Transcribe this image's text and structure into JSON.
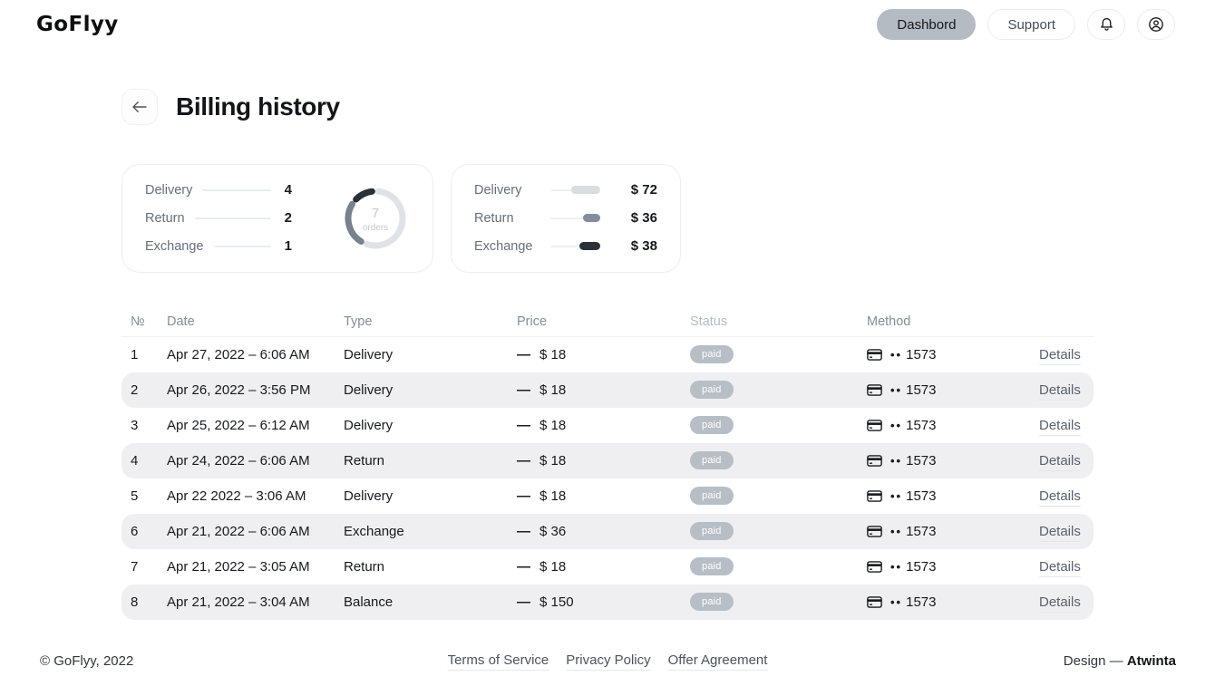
{
  "header": {
    "logo": "GoFlyy",
    "nav": [
      {
        "label": "Dashbord",
        "active": true
      },
      {
        "label": "Support",
        "active": false
      }
    ],
    "icons": {
      "notifications": "bell-icon",
      "account": "profile-icon"
    }
  },
  "page": {
    "title": "Billing history"
  },
  "summary": {
    "orders": {
      "items": [
        {
          "label": "Delivery",
          "value": "4"
        },
        {
          "label": "Return",
          "value": "2"
        },
        {
          "label": "Exchange",
          "value": "1"
        }
      ],
      "donut": {
        "total": "7",
        "unit": "orders"
      }
    },
    "amounts": {
      "items": [
        {
          "label": "Delivery",
          "value": "$ 72",
          "bar_pct": 58,
          "color": "#d9dde2"
        },
        {
          "label": "Return",
          "value": "$ 36",
          "bar_pct": 34,
          "color": "#848d99"
        },
        {
          "label": "Exchange",
          "value": "$ 38",
          "bar_pct": 42,
          "color": "#2c3138"
        }
      ]
    }
  },
  "chart_data": [
    {
      "type": "pie",
      "title": "Orders by type",
      "categories": [
        "Delivery",
        "Return",
        "Exchange"
      ],
      "values": [
        4,
        2,
        1
      ],
      "center_label": "7 orders",
      "colors": [
        "#dfe2e7",
        "#78818e",
        "#2b2f36"
      ],
      "legend_position": "left"
    },
    {
      "type": "bar",
      "title": "Amount by type",
      "categories": [
        "Delivery",
        "Return",
        "Exchange"
      ],
      "values": [
        72,
        36,
        38
      ],
      "unit": "$",
      "colors": [
        "#d9dde2",
        "#848d99",
        "#2c3138"
      ]
    }
  ],
  "table": {
    "columns": [
      "№",
      "Date",
      "Type",
      "Price",
      "Status",
      "Method"
    ],
    "price_sign": "—",
    "method_prefix": "••",
    "details_label": "Details",
    "rows": [
      {
        "num": "1",
        "date": "Apr 27, 2022 – 6:06 AM",
        "type": "Delivery",
        "price": "$ 18",
        "status": "paid",
        "method": "1573"
      },
      {
        "num": "2",
        "date": "Apr 26, 2022 – 3:56 PM",
        "type": "Delivery",
        "price": "$ 18",
        "status": "paid",
        "method": "1573"
      },
      {
        "num": "3",
        "date": "Apr 25, 2022 – 6:12 AM",
        "type": "Delivery",
        "price": "$ 18",
        "status": "paid",
        "method": "1573"
      },
      {
        "num": "4",
        "date": "Apr 24, 2022 – 6:06 AM",
        "type": "Return",
        "price": "$ 18",
        "status": "paid",
        "method": "1573"
      },
      {
        "num": "5",
        "date": "Apr 22 2022 – 3:06 AM",
        "type": "Delivery",
        "price": "$ 18",
        "status": "paid",
        "method": "1573"
      },
      {
        "num": "6",
        "date": "Apr 21, 2022 – 6:06 AM",
        "type": "Exchange",
        "price": "$ 36",
        "status": "paid",
        "method": "1573"
      },
      {
        "num": "7",
        "date": "Apr 21, 2022 – 3:05 AM",
        "type": "Return",
        "price": "$ 18",
        "status": "paid",
        "method": "1573"
      },
      {
        "num": "8",
        "date": "Apr 21, 2022 – 3:04 AM",
        "type": "Balance",
        "price": "$ 150",
        "status": "paid",
        "method": "1573"
      }
    ]
  },
  "footer": {
    "copyright": "© GoFlyy, 2022",
    "links": [
      "Terms of Service",
      "Privacy Policy",
      "Offer Agreement"
    ],
    "design_prefix": "Design — ",
    "design_name": "Atwinta"
  }
}
